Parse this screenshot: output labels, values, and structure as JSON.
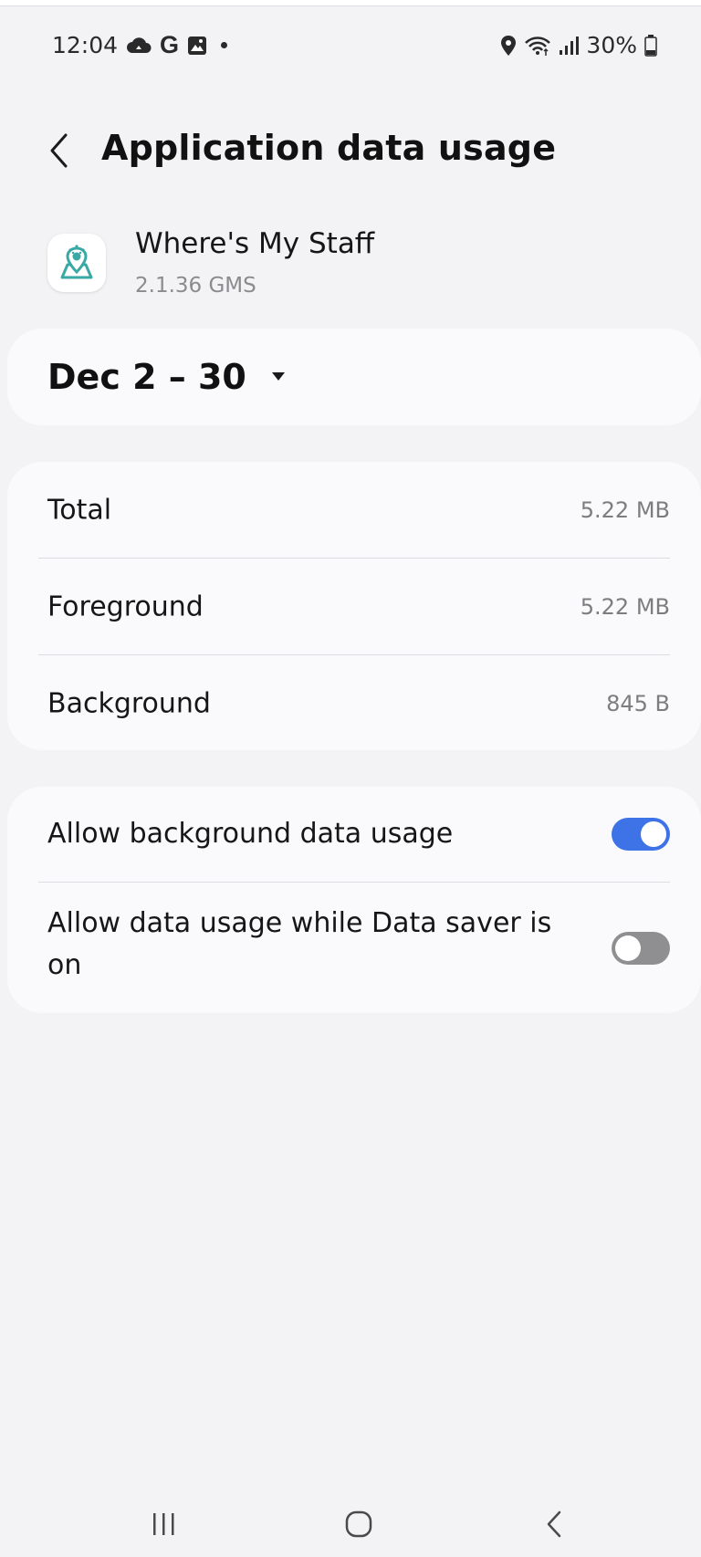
{
  "status_bar": {
    "time": "12:04",
    "battery_percent": "30%",
    "left_icons": [
      "cloud-icon",
      "google-icon",
      "gallery-icon",
      "notification-dot-icon"
    ],
    "right_icons": [
      "location-icon",
      "wifi-icon",
      "signal-icon",
      "battery-icon"
    ],
    "google_glyph": "G",
    "battery_level": 0.3
  },
  "header": {
    "title": "Application data usage",
    "back_icon": "chevron-left-icon"
  },
  "app": {
    "name": "Where's My Staff",
    "version": "2.1.36 GMS",
    "icon": "map-pin-app-icon"
  },
  "date_range": {
    "label": "Dec 2 – 30",
    "dropdown_icon": "triangle-down-icon"
  },
  "usage": {
    "rows": [
      {
        "label": "Total",
        "value": "5.22 MB"
      },
      {
        "label": "Foreground",
        "value": "5.22 MB"
      },
      {
        "label": "Background",
        "value": "845 B"
      }
    ]
  },
  "toggles": [
    {
      "label": "Allow background data usage",
      "on": true
    },
    {
      "label": "Allow data usage while Data saver is on",
      "on": false
    }
  ],
  "nav_bar": {
    "items": [
      "recents-icon",
      "home-icon",
      "back-icon"
    ]
  },
  "colors": {
    "background": "#f3f3f6",
    "card": "#fafafc",
    "accent": "#3e73e8",
    "switch_off": "#8f8f92",
    "app_icon_teal": "#3aa8a4"
  }
}
